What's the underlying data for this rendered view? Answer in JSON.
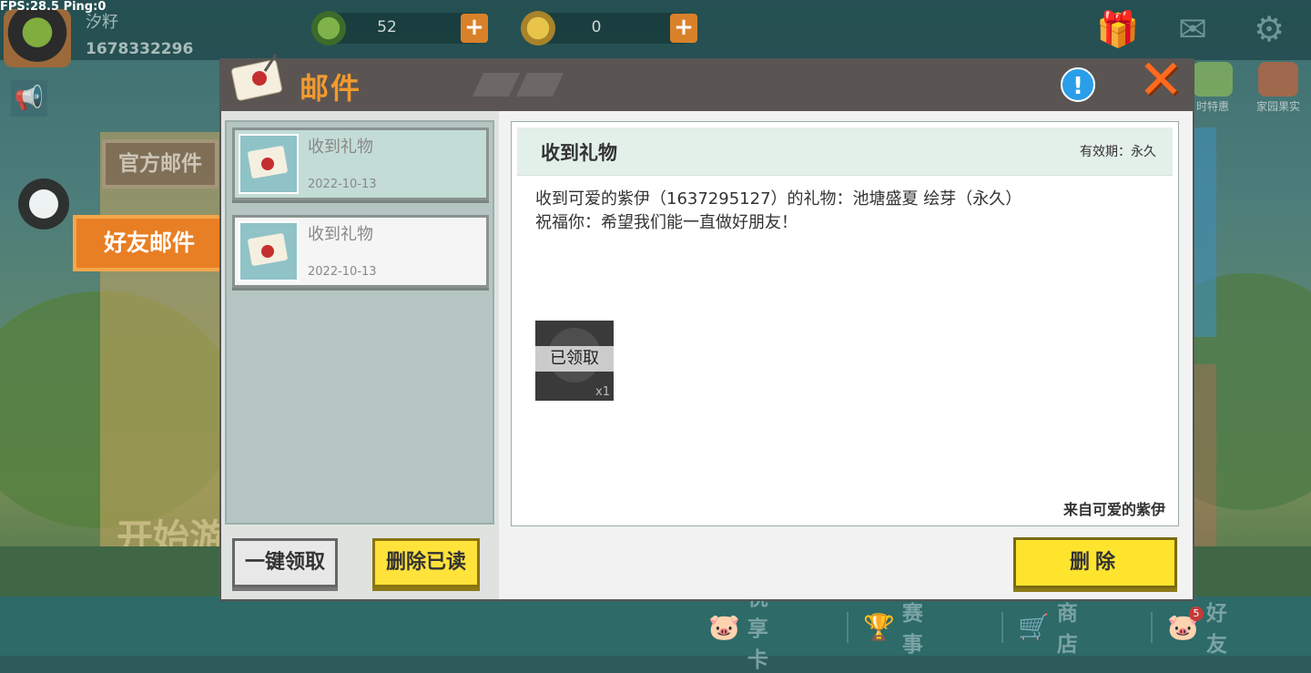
{
  "hud": {
    "fps_text": "FPS:28.5  Ping:0",
    "player_name": "汐籽",
    "player_id": "1678332296",
    "currency1_amount": "52",
    "currency2_amount": "0",
    "plus_symbol": "+"
  },
  "promos": [
    {
      "label": "时特惠"
    },
    {
      "label": "家园果实"
    }
  ],
  "side_tabs": {
    "official": "官方邮件",
    "friend": "好友邮件"
  },
  "background": {
    "start_text": "开始游"
  },
  "mail": {
    "title": "邮件",
    "info_symbol": "!",
    "close_symbol": "✕",
    "items": [
      {
        "subject": "收到礼物",
        "date": "2022-10-13"
      },
      {
        "subject": "收到礼物",
        "date": "2022-10-13"
      }
    ],
    "claim_all_label": "一键领取",
    "delete_read_label": "删除已读",
    "detail": {
      "subject": "收到礼物",
      "validity": "有效期：永久",
      "line1": "收到可爱的紫伊（1637295127）的礼物：池塘盛夏 绘芽（永久）",
      "line2": "祝福你：希望我们能一直做好朋友！",
      "gift_status": "已领取",
      "gift_qty": "x1",
      "sender": "来自可爱的紫伊"
    },
    "delete_label": "删除"
  },
  "bottom_nav": [
    {
      "label": "悦享卡"
    },
    {
      "label": "赛事"
    },
    {
      "label": "商店"
    },
    {
      "label": "好友",
      "badge": "5"
    }
  ],
  "colors": {
    "accent_orange": "#f29a2f",
    "button_yellow": "#ffe23a",
    "active_tab": "#e87f24"
  }
}
